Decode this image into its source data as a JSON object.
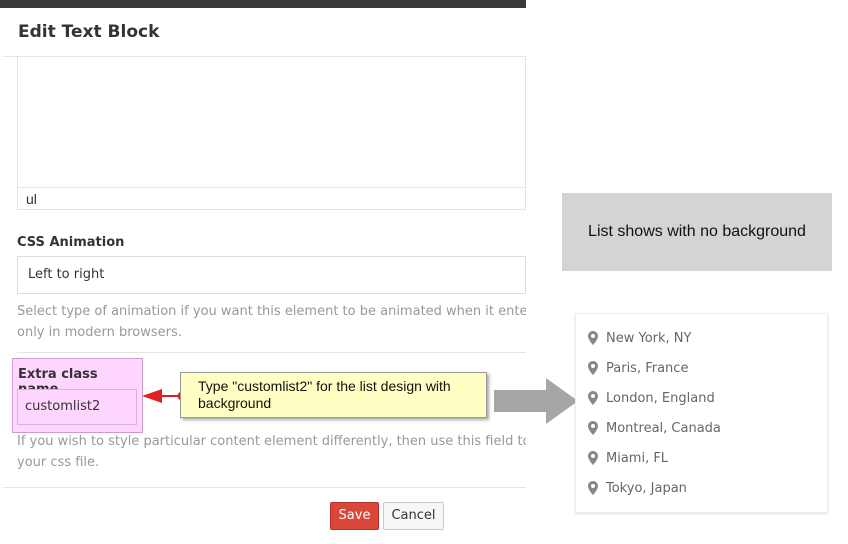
{
  "modal": {
    "title": "Edit Text Block",
    "editor_path": "ul"
  },
  "css_animation": {
    "label": "CSS Animation",
    "value": "Left to right",
    "help_line1": "Select type of animation if you want this element to be animated when it enters into the",
    "help_line2": "only in modern browsers."
  },
  "extra_class": {
    "label": "Extra class name",
    "value": "customlist2",
    "help_line1": "If you wish to style particular content element differently, then use this field to add a c",
    "help_line2": "your css file."
  },
  "callout": {
    "text": "Type \"customlist2\" for the list design with background"
  },
  "buttons": {
    "save": "Save",
    "cancel": "Cancel"
  },
  "info_box": {
    "text": "List shows with no background"
  },
  "location_list": {
    "items": [
      "New York, NY",
      "Paris, France",
      "London, England",
      "Montreal, Canada",
      "Miami, FL",
      "Tokyo, Japan"
    ]
  },
  "colors": {
    "save_button": "#d9473b",
    "highlight": "#ffd6ff",
    "callout_bg": "#ffffc4",
    "info_box_bg": "#d4d4d4",
    "arrow": "#a6a6a6",
    "annotation_red": "#e02020"
  },
  "icons": {
    "location": "map-marker-icon"
  }
}
